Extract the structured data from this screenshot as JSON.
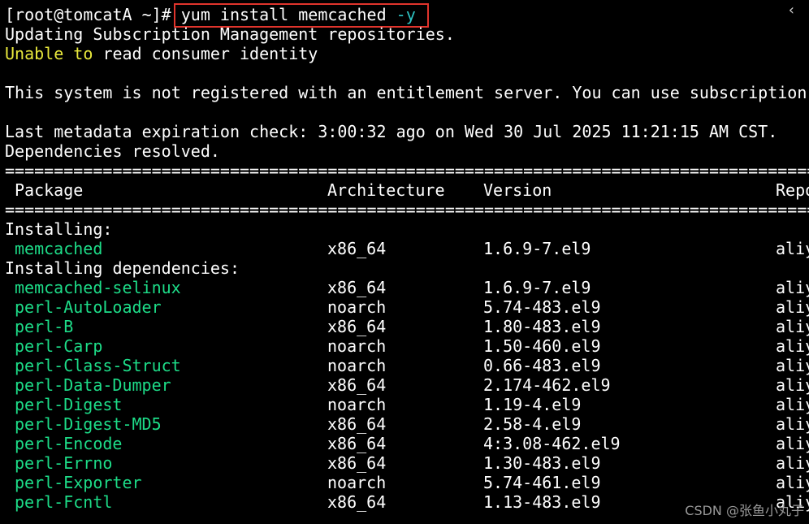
{
  "terminal": {
    "prompt": "[root@tomcatA ~]#",
    "command": {
      "base": "yum install memcached",
      "flag": "-y"
    },
    "collapse_glyph": "‹",
    "messages": {
      "updating": "Updating Subscription Management repositories.",
      "unable_word1": "Unable",
      "unable_word2": "to",
      "unable_rest": "read consumer identity",
      "not_registered": "This system is not registered with an entitlement server. You can use subscription-",
      "metadata": "Last metadata expiration check: 3:00:32 ago on Wed 30 Jul 2025 11:21:15 AM CST.",
      "deps_resolved": "Dependencies resolved."
    },
    "separator": "==========================================================================================",
    "headers": {
      "package": "Package",
      "architecture": "Architecture",
      "version": "Version",
      "repo": "Repo"
    },
    "sections": {
      "installing": "Installing:",
      "installing_deps": "Installing dependencies:"
    },
    "packages": [
      {
        "name": "memcached",
        "arch": "x86_64",
        "version": "1.6.9-7.el9",
        "repo": "aliy"
      },
      {
        "name": "memcached-selinux",
        "arch": "x86_64",
        "version": "1.6.9-7.el9",
        "repo": "aliy"
      },
      {
        "name": "perl-AutoLoader",
        "arch": "noarch",
        "version": "5.74-483.el9",
        "repo": "aliy"
      },
      {
        "name": "perl-B",
        "arch": "x86_64",
        "version": "1.80-483.el9",
        "repo": "aliy"
      },
      {
        "name": "perl-Carp",
        "arch": "noarch",
        "version": "1.50-460.el9",
        "repo": "aliy"
      },
      {
        "name": "perl-Class-Struct",
        "arch": "noarch",
        "version": "0.66-483.el9",
        "repo": "aliy"
      },
      {
        "name": "perl-Data-Dumper",
        "arch": "x86_64",
        "version": "2.174-462.el9",
        "repo": "aliy"
      },
      {
        "name": "perl-Digest",
        "arch": "noarch",
        "version": "1.19-4.el9",
        "repo": "aliy"
      },
      {
        "name": "perl-Digest-MD5",
        "arch": "x86_64",
        "version": "2.58-4.el9",
        "repo": "aliy"
      },
      {
        "name": "perl-Encode",
        "arch": "x86_64",
        "version": "4:3.08-462.el9",
        "repo": "aliy"
      },
      {
        "name": "perl-Errno",
        "arch": "x86_64",
        "version": "1.30-483.el9",
        "repo": "aliy"
      },
      {
        "name": "perl-Exporter",
        "arch": "noarch",
        "version": "5.74-461.el9",
        "repo": "aliy"
      },
      {
        "name": "perl-Fcntl",
        "arch": "x86_64",
        "version": "1.13-483.el9",
        "repo": "aliy"
      }
    ],
    "watermark": "CSDN @张鱼小丸子"
  },
  "colors": {
    "background": "#000000",
    "text": "#ffffff",
    "package_green": "#1ddc88",
    "flag_cyan": "#2ec4c4",
    "warning_yellow": "#e8e83c",
    "highlight_red": "#e0342c"
  }
}
